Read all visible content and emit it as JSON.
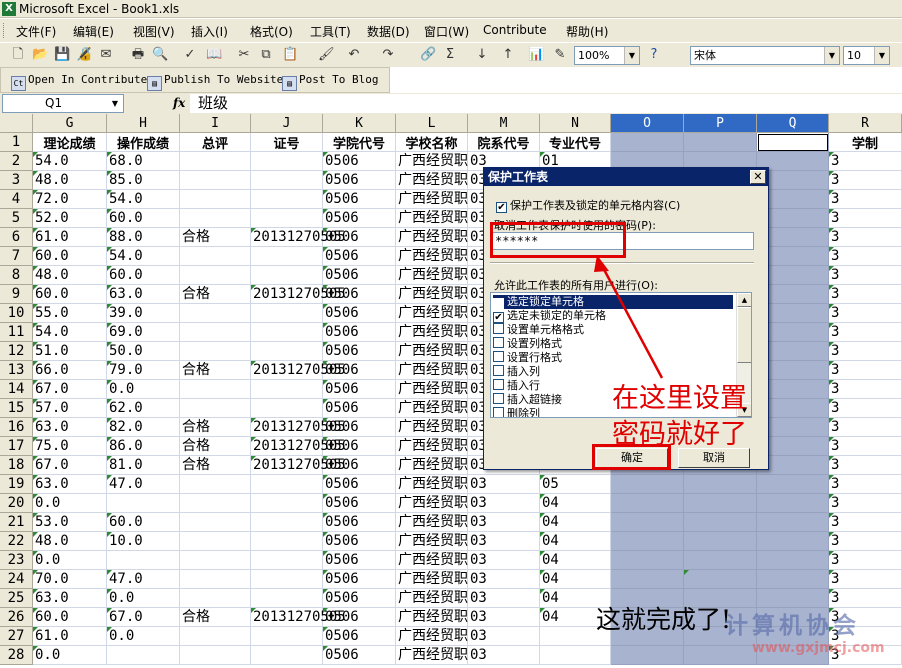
{
  "window": {
    "title": "Microsoft Excel - Book1.xls"
  },
  "menu": [
    "文件(F)",
    "编辑(E)",
    "视图(V)",
    "插入(I)",
    "格式(O)",
    "工具(T)",
    "数据(D)",
    "窗口(W)",
    "Contribute",
    "帮助(H)"
  ],
  "toolbar": {
    "zoom": "100%",
    "font": "宋体",
    "size": "10"
  },
  "contribute": [
    "Open In Contribute",
    "Publish To Website",
    "Post To Blog"
  ],
  "formula": {
    "cell_ref": "Q1",
    "fx": "fx",
    "content": "班级"
  },
  "columns": [
    "G",
    "H",
    "I",
    "J",
    "K",
    "L",
    "M",
    "N",
    "O",
    "P",
    "Q",
    "R"
  ],
  "headers": [
    "理论成绩",
    "操作成绩",
    "总评",
    "证号",
    "学院代号",
    "学校名称",
    "院系代号",
    "专业代号",
    "",
    "",
    "",
    "学制"
  ],
  "rows": [
    {
      "n": "1"
    },
    {
      "n": "2",
      "g": "54.0",
      "h": "68.0",
      "i": "",
      "j": "",
      "k": "0506",
      "l": "广西经贸职",
      "m": "03",
      "nn": "01",
      "r": "3"
    },
    {
      "n": "3",
      "g": "48.0",
      "h": "85.0",
      "i": "",
      "j": "",
      "k": "0506",
      "l": "广西经贸职",
      "m": "03",
      "nn": "",
      "r": "3"
    },
    {
      "n": "4",
      "g": "72.0",
      "h": "54.0",
      "i": "",
      "j": "",
      "k": "0506",
      "l": "广西经贸职",
      "m": "03",
      "nn": "",
      "r": "3"
    },
    {
      "n": "5",
      "g": "52.0",
      "h": "60.0",
      "i": "",
      "j": "",
      "k": "0506",
      "l": "广西经贸职",
      "m": "03",
      "nn": "",
      "r": "3"
    },
    {
      "n": "6",
      "g": "61.0",
      "h": "88.0",
      "i": "合格",
      "j": "20131270505",
      "k": "0506",
      "l": "广西经贸职",
      "m": "03",
      "nn": "",
      "r": "3"
    },
    {
      "n": "7",
      "g": "60.0",
      "h": "54.0",
      "i": "",
      "j": "",
      "k": "0506",
      "l": "广西经贸职",
      "m": "03",
      "nn": "",
      "r": "3"
    },
    {
      "n": "8",
      "g": "48.0",
      "h": "60.0",
      "i": "",
      "j": "",
      "k": "0506",
      "l": "广西经贸职",
      "m": "03",
      "nn": "",
      "r": "3"
    },
    {
      "n": "9",
      "g": "60.0",
      "h": "63.0",
      "i": "合格",
      "j": "20131270505",
      "k": "0506",
      "l": "广西经贸职",
      "m": "03",
      "nn": "",
      "r": "3"
    },
    {
      "n": "10",
      "g": "55.0",
      "h": "39.0",
      "i": "",
      "j": "",
      "k": "0506",
      "l": "广西经贸职",
      "m": "03",
      "nn": "",
      "r": "3"
    },
    {
      "n": "11",
      "g": "54.0",
      "h": "69.0",
      "i": "",
      "j": "",
      "k": "0506",
      "l": "广西经贸职",
      "m": "03",
      "nn": "",
      "r": "3"
    },
    {
      "n": "12",
      "g": "51.0",
      "h": "50.0",
      "i": "",
      "j": "",
      "k": "0506",
      "l": "广西经贸职",
      "m": "03",
      "nn": "",
      "r": "3"
    },
    {
      "n": "13",
      "g": "66.0",
      "h": "79.0",
      "i": "合格",
      "j": "20131270505",
      "k": "0506",
      "l": "广西经贸职",
      "m": "03",
      "nn": "",
      "r": "3"
    },
    {
      "n": "14",
      "g": "67.0",
      "h": "0.0",
      "i": "",
      "j": "",
      "k": "0506",
      "l": "广西经贸职",
      "m": "03",
      "nn": "",
      "r": "3"
    },
    {
      "n": "15",
      "g": "57.0",
      "h": "62.0",
      "i": "",
      "j": "",
      "k": "0506",
      "l": "广西经贸职",
      "m": "03",
      "nn": "",
      "r": "3"
    },
    {
      "n": "16",
      "g": "63.0",
      "h": "82.0",
      "i": "合格",
      "j": "20131270505",
      "k": "0506",
      "l": "广西经贸职",
      "m": "03",
      "nn": "",
      "r": "3"
    },
    {
      "n": "17",
      "g": "75.0",
      "h": "86.0",
      "i": "合格",
      "j": "20131270505",
      "k": "0506",
      "l": "广西经贸职",
      "m": "03",
      "nn": "",
      "r": "3"
    },
    {
      "n": "18",
      "g": "67.0",
      "h": "81.0",
      "i": "合格",
      "j": "20131270505",
      "k": "0506",
      "l": "广西经贸职",
      "m": "03",
      "nn": "",
      "r": "3"
    },
    {
      "n": "19",
      "g": "63.0",
      "h": "47.0",
      "i": "",
      "j": "",
      "k": "0506",
      "l": "广西经贸职",
      "m": "03",
      "nn": "05",
      "r": "3"
    },
    {
      "n": "20",
      "g": "0.0",
      "h": "",
      "i": "",
      "j": "",
      "k": "0506",
      "l": "广西经贸职",
      "m": "03",
      "nn": "04",
      "r": "3"
    },
    {
      "n": "21",
      "g": "53.0",
      "h": "60.0",
      "i": "",
      "j": "",
      "k": "0506",
      "l": "广西经贸职",
      "m": "03",
      "nn": "04",
      "r": "3"
    },
    {
      "n": "22",
      "g": "48.0",
      "h": "10.0",
      "i": "",
      "j": "",
      "k": "0506",
      "l": "广西经贸职",
      "m": "03",
      "nn": "04",
      "r": "3"
    },
    {
      "n": "23",
      "g": "0.0",
      "h": "",
      "i": "",
      "j": "",
      "k": "0506",
      "l": "广西经贸职",
      "m": "03",
      "nn": "04",
      "r": "3"
    },
    {
      "n": "24",
      "g": "70.0",
      "h": "47.0",
      "i": "",
      "j": "",
      "k": "0506",
      "l": "广西经贸职",
      "m": "03",
      "nn": "04",
      "r": "3"
    },
    {
      "n": "25",
      "g": "63.0",
      "h": "0.0",
      "i": "",
      "j": "",
      "k": "0506",
      "l": "广西经贸职",
      "m": "03",
      "nn": "04",
      "r": "3"
    },
    {
      "n": "26",
      "g": "60.0",
      "h": "67.0",
      "i": "合格",
      "j": "20131270505",
      "k": "0506",
      "l": "广西经贸职",
      "m": "03",
      "nn": "04",
      "r": "3"
    },
    {
      "n": "27",
      "g": "61.0",
      "h": "0.0",
      "i": "",
      "j": "",
      "k": "0506",
      "l": "广西经贸职",
      "m": "03",
      "nn": "",
      "r": "3"
    },
    {
      "n": "28",
      "g": "0.0",
      "h": "",
      "i": "",
      "j": "",
      "k": "0506",
      "l": "广西经贸职",
      "m": "03",
      "nn": "",
      "r": "3"
    }
  ],
  "dialog": {
    "title": "保护工作表",
    "protect_label": "保护工作表及锁定的单元格内容(C)",
    "password_label": "取消工作表保护时使用的密码(P):",
    "password_value": "******",
    "allow_label": "允许此工作表的所有用户进行(O):",
    "permissions": [
      {
        "label": "选定锁定单元格",
        "checked": true
      },
      {
        "label": "选定未锁定的单元格",
        "checked": true
      },
      {
        "label": "设置单元格格式",
        "checked": false
      },
      {
        "label": "设置列格式",
        "checked": false
      },
      {
        "label": "设置行格式",
        "checked": false
      },
      {
        "label": "插入列",
        "checked": false
      },
      {
        "label": "插入行",
        "checked": false
      },
      {
        "label": "插入超链接",
        "checked": false
      },
      {
        "label": "删除列",
        "checked": false
      }
    ],
    "ok": "确定",
    "cancel": "取消"
  },
  "annotation": {
    "line1": "在这里设置",
    "line2": "密码就好了",
    "done": "这就完成了!",
    "watermark": "计算机协会",
    "watermark_url": "www.gxjmcj.com"
  }
}
